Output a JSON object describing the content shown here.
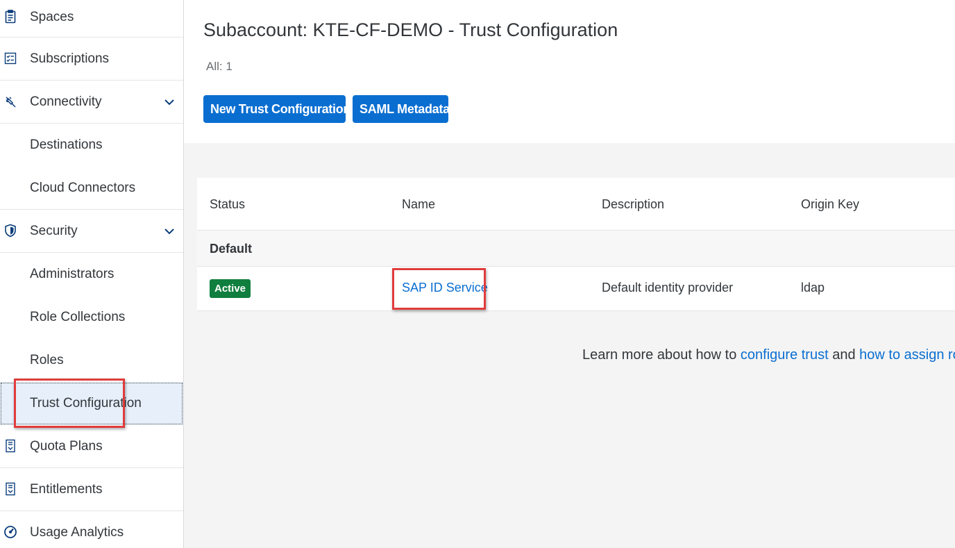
{
  "sidebar": {
    "items": [
      {
        "label": "Spaces"
      },
      {
        "label": "Subscriptions"
      },
      {
        "label": "Connectivity"
      },
      {
        "label": "Destinations"
      },
      {
        "label": "Cloud Connectors"
      },
      {
        "label": "Security"
      },
      {
        "label": "Administrators"
      },
      {
        "label": "Role Collections"
      },
      {
        "label": "Roles"
      },
      {
        "label": "Trust Configuration"
      },
      {
        "label": "Quota Plans"
      },
      {
        "label": "Entitlements"
      },
      {
        "label": "Usage Analytics"
      }
    ]
  },
  "page": {
    "title": "Subaccount: KTE-CF-DEMO - Trust Configuration",
    "count": "All: 1"
  },
  "toolbar": {
    "new_label": "New Trust Configuration",
    "saml_label": "SAML Metadata"
  },
  "table": {
    "headers": [
      "Status",
      "Name",
      "Description",
      "Origin Key"
    ],
    "group": "Default",
    "rows": [
      {
        "status": "Active",
        "name": "SAP ID Service",
        "description": "Default identity provider",
        "origin": "ldap"
      }
    ]
  },
  "footer": {
    "prefix": "Learn more about how to ",
    "link1": "configure trust",
    "middle": " and ",
    "link2": "how to assign role c"
  },
  "colors": {
    "accent": "#0a6ed1",
    "status_active": "#107e3e",
    "highlight": "#e03c3c",
    "selected_bg": "#e6effa"
  },
  "icons": {
    "spaces": "clipboard-icon",
    "subscriptions": "checklist-icon",
    "connectivity": "plug-icon",
    "security": "shield-icon",
    "quota_plans": "document-icon",
    "entitlements": "document-icon",
    "usage_analytics": "gauge-icon"
  }
}
